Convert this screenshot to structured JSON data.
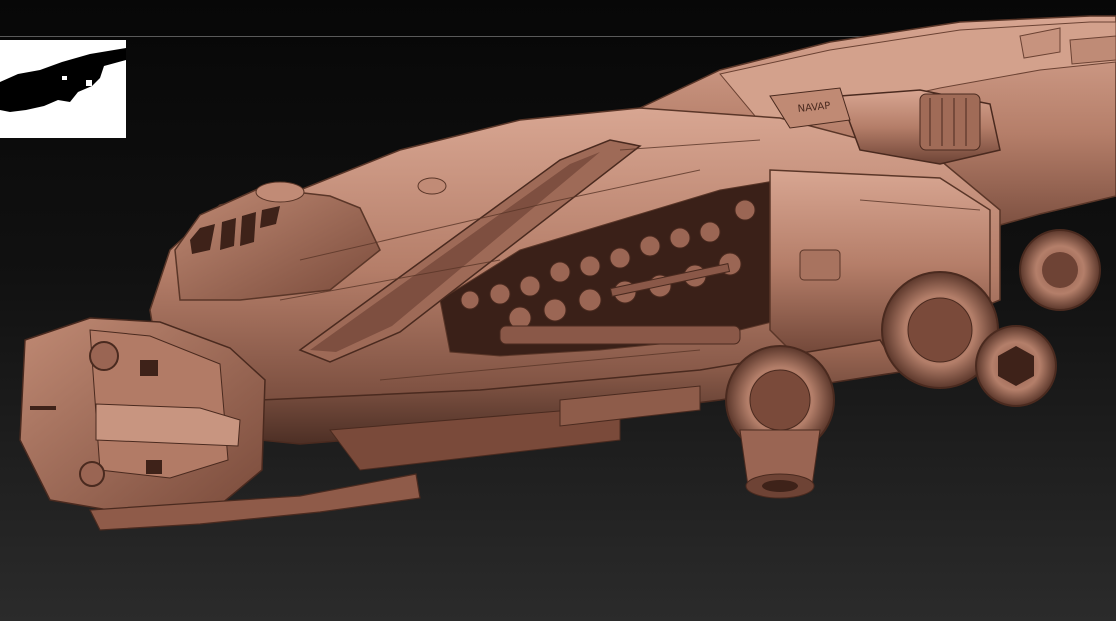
{
  "app": {
    "canvas_background_top": "#0a0a0a",
    "canvas_background_bottom": "#2a2a2a",
    "material_color": "#b9826d",
    "material_shadow": "#5e3a2e",
    "material_highlight": "#e3b5a0"
  },
  "navigator": {
    "icon": "navigator-thumbnail-icon",
    "background": "#ffffff",
    "silhouette": "#000000"
  },
  "model": {
    "icon": "dropship-sculpt-icon",
    "decal_text": "NAVAP"
  }
}
